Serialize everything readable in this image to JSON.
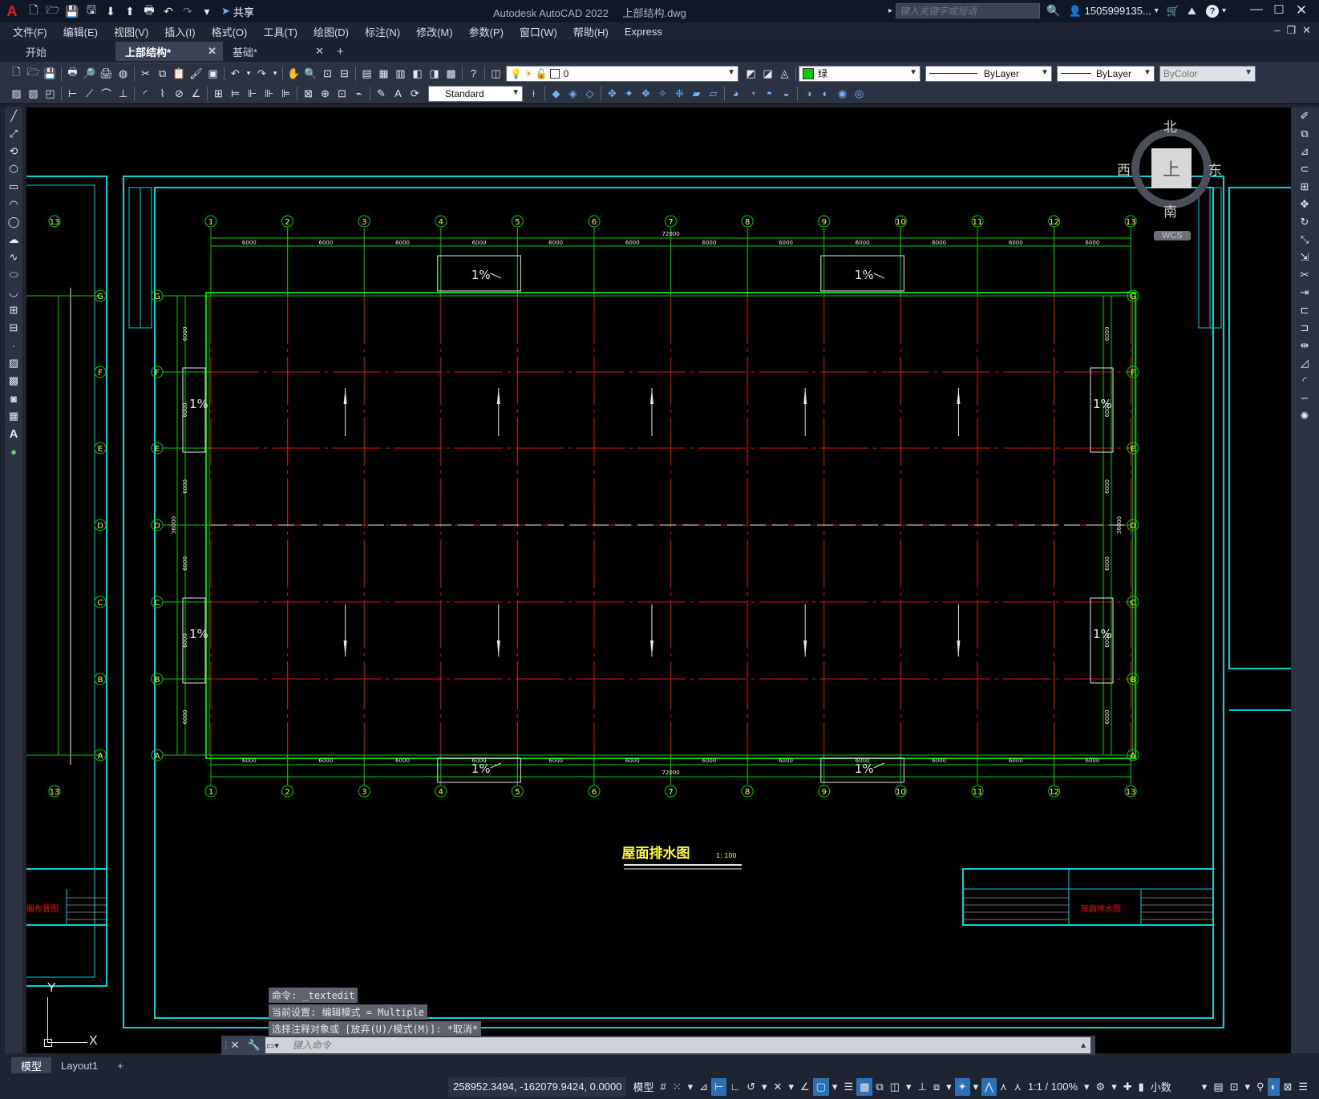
{
  "titlebar": {
    "app_title": "Autodesk AutoCAD 2022",
    "file_name": "上部结构.dwg",
    "share_label": "共享",
    "search_placeholder": "键入关键字或短语",
    "user_name": "1505999135..."
  },
  "menubar": [
    "文件(F)",
    "编辑(E)",
    "视图(V)",
    "插入(I)",
    "格式(O)",
    "工具(T)",
    "绘图(D)",
    "标注(N)",
    "修改(M)",
    "参数(P)",
    "窗口(W)",
    "帮助(H)",
    "Express"
  ],
  "doc_tabs": [
    {
      "label": "开始",
      "active": false,
      "closable": false
    },
    {
      "label": "上部结构*",
      "active": true,
      "closable": true
    },
    {
      "label": "基础*",
      "active": false,
      "closable": true
    }
  ],
  "toolbar": {
    "layer_value": "0",
    "color_value": "绿",
    "linetype_value": "ByLayer",
    "lineweight_value": "ByLayer",
    "plotstyle_value": "ByColor",
    "textstyle_value": "Standard"
  },
  "viewcube": {
    "north": "北",
    "south": "南",
    "east": "东",
    "west": "西",
    "face": "上",
    "wcs": "WCS"
  },
  "drawing": {
    "grid_numbers": [
      "1",
      "2",
      "3",
      "4",
      "5",
      "6",
      "7",
      "8",
      "9",
      "10",
      "11",
      "12",
      "13"
    ],
    "grid_letters": [
      "G",
      "F",
      "E",
      "D",
      "C",
      "B",
      "A"
    ],
    "span_dim": "6000",
    "total_dim": "72000",
    "height_dim": "36000",
    "slope_label": "1%",
    "title": "屋面排水图",
    "scale": "1: 100",
    "titleblock_left": "平面布置图",
    "titleblock_right": "屋面排水图"
  },
  "ucs": {
    "x": "X",
    "y": "Y"
  },
  "command": {
    "history": [
      "命令: _textedit",
      "当前设置: 编辑模式 = Multiple",
      "选择注释对象或 [放弃(U)/模式(M)]: *取消*"
    ],
    "placeholder": "键入命令"
  },
  "layout_tabs": [
    {
      "label": "模型",
      "active": true
    },
    {
      "label": "Layout1",
      "active": false
    }
  ],
  "statusbar": {
    "coordinates": "258952.3494, -162079.9424, 0.0000",
    "model_label": "模型",
    "annotation_scale": "1:1 / 100%",
    "units": "小数"
  }
}
